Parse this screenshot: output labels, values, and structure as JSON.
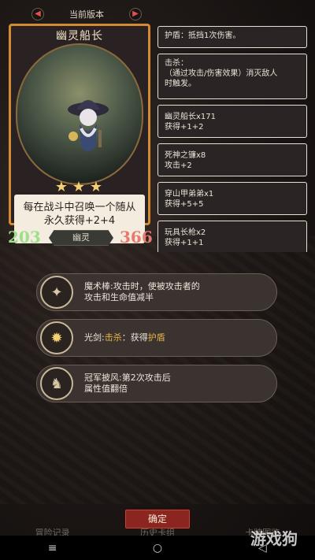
{
  "header": {
    "title": "当前版本"
  },
  "card": {
    "name": "幽灵船长",
    "stars": 3,
    "description_lines": [
      "每在战斗中召唤一个随从",
      "永久获得+2+4"
    ],
    "attack": "203",
    "health": "366",
    "tribe": "幽灵"
  },
  "right_panel": {
    "shield": "护盾：抵挡1次伤害。",
    "kill_lines": [
      "击杀：",
      "（通过攻击/伤害效果）消灭敌人",
      "时触发。"
    ],
    "buffs": [
      {
        "name": "幽灵船长x171",
        "value": "获得+1+2"
      },
      {
        "name": "死神之镰x8",
        "value": "攻击+2"
      },
      {
        "name": "穿山甲弟弟x1",
        "value": "获得+5+5"
      },
      {
        "name": "玩具长枪x2",
        "value": "获得+1+1"
      }
    ]
  },
  "skills": [
    {
      "icon": "wand-icon",
      "line1": "魔术棒:攻击时，使被攻击者的",
      "line2": "攻击和生命值减半"
    },
    {
      "icon": "lightsaber-icon",
      "prefix": "光剑:",
      "kw1": "击杀",
      "mid": "：获得",
      "kw2": "护盾"
    },
    {
      "icon": "cape-icon",
      "line1": "冠军披风:第2次攻击后",
      "line2": "属性值翻倍"
    }
  ],
  "confirm_label": "确定",
  "bottom_nav": [
    "冒险记录",
    "历史卡组",
    "卡牌图鉴"
  ],
  "watermark": "游戏狗",
  "colors": {
    "accent_orange": "#d48a33",
    "attack_green": "#9be08a",
    "health_red": "#e67a6e",
    "keyword_gold": "#e6b34a",
    "confirm_red": "#8b2520"
  }
}
